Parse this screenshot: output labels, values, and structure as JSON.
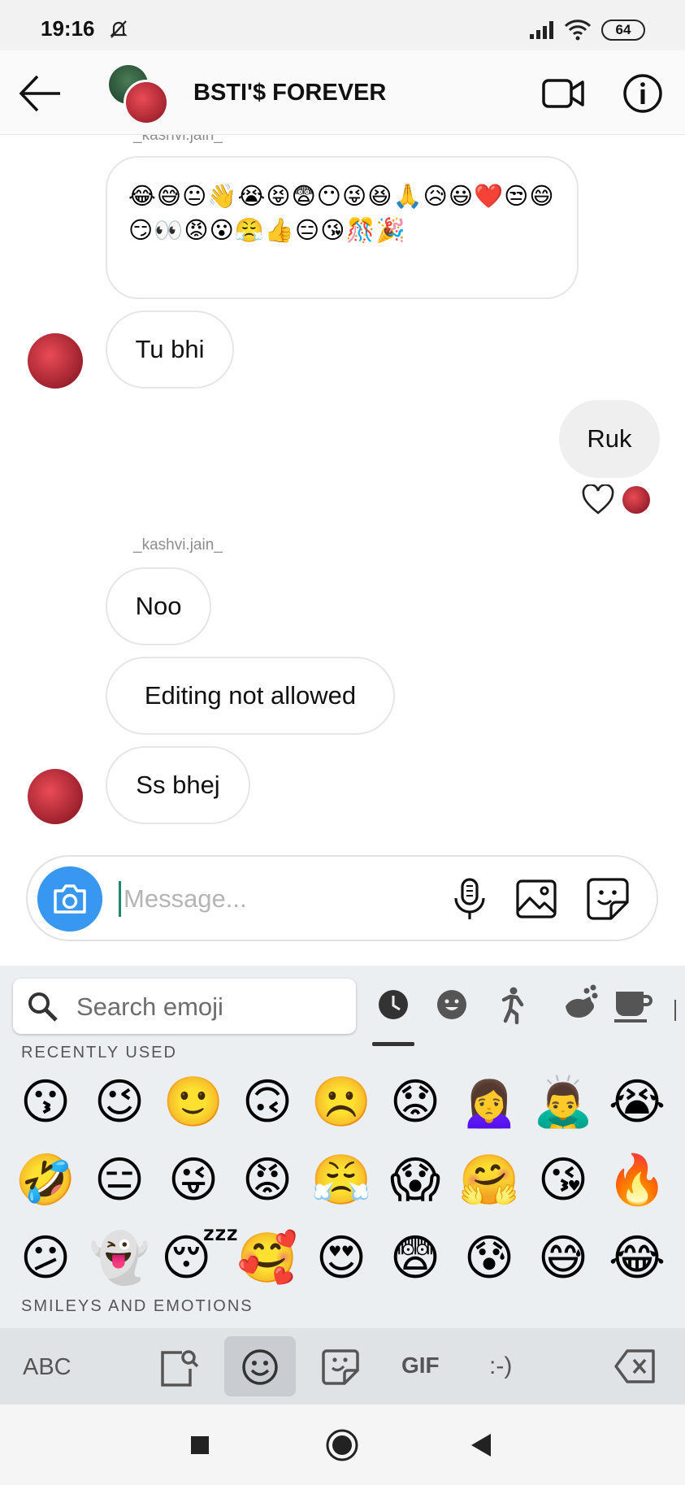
{
  "status_bar": {
    "time": "19:16",
    "battery": "64"
  },
  "header": {
    "title": "BSTI'$ FOREVER"
  },
  "chat": {
    "top_sender": "_kashvi.jain_",
    "emoji_message": "😂😅😐👋😭😝😨😶😜😆🙏😥😃❤️😒😄😏👀😡😮😤👍😑😘🎊🎉",
    "messages": [
      {
        "text": "Tu bhi",
        "mine": false
      },
      {
        "text": "Ruk",
        "mine": true
      },
      {
        "text": "Noo",
        "mine": false
      },
      {
        "text": "Editing not allowed",
        "mine": false
      },
      {
        "text": "Ss bhej",
        "mine": false
      }
    ],
    "second_sender": "_kashvi.jain_"
  },
  "composer": {
    "placeholder": "Message..."
  },
  "keyboard": {
    "search_placeholder": "Search emoji",
    "recent_label": "RECENTLY USED",
    "smileys_label": "SMILEYS AND EMOTIONS",
    "recent_emojis": [
      "😗",
      "😉",
      "🙂",
      "🙃",
      "☹️",
      "😟",
      "🙍‍♀️",
      "🙇‍♂️",
      "😭",
      "🤣",
      "😑",
      "😜",
      "😡",
      "😤",
      "😱",
      "🤗",
      "😘",
      "🔥",
      "😕",
      "👻",
      "😴",
      "🥰",
      "😍",
      "😨",
      "😰",
      "😅",
      "😂"
    ],
    "abc_label": "ABC",
    "gif_label": "GIF",
    "emoticon_label": ":-)"
  }
}
